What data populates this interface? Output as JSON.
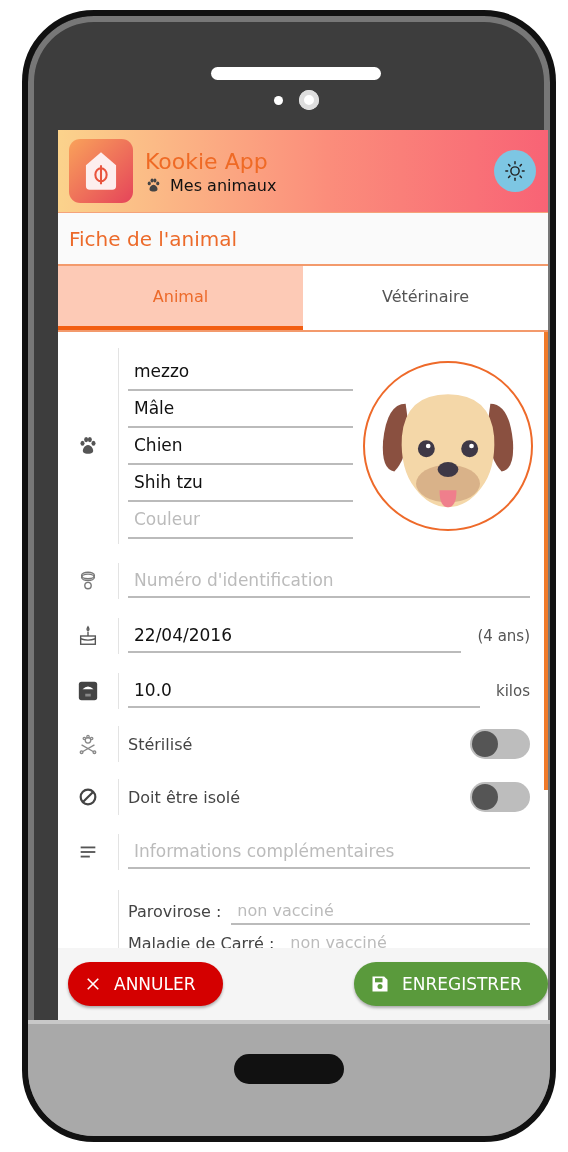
{
  "header": {
    "app_title": "Kookie App",
    "subtitle": "Mes animaux"
  },
  "page_title": "Fiche de l'animal",
  "tabs": [
    {
      "label": "Animal",
      "selected": true
    },
    {
      "label": "Vétérinaire",
      "selected": false
    }
  ],
  "profile_fields": [
    {
      "value": "mezzo"
    },
    {
      "value": "Mâle"
    },
    {
      "value": "Chien"
    },
    {
      "value": "Shih tzu"
    },
    {
      "placeholder": "Couleur"
    }
  ],
  "rows": [
    {
      "kind": "field",
      "placeholder": "Numéro d'identification"
    },
    {
      "kind": "field",
      "value": "22/04/2016",
      "suffix": "(4 ans)"
    },
    {
      "kind": "field",
      "value": "10.0",
      "suffix": "kilos"
    },
    {
      "kind": "toggle",
      "label": "Stérilisé",
      "on": false
    },
    {
      "kind": "toggle",
      "label": "Doit être isolé",
      "on": false
    },
    {
      "kind": "field",
      "placeholder": "Informations complémentaires"
    }
  ],
  "vaccines": [
    {
      "label": "Parovirose :",
      "placeholder": "non vacciné"
    },
    {
      "label": "Maladie de Carré :",
      "placeholder": "non vacciné"
    }
  ],
  "buttons": [
    {
      "kind": "cancel",
      "label": "ANNULER"
    },
    {
      "kind": "save",
      "label": "ENREGISTRER"
    }
  ]
}
